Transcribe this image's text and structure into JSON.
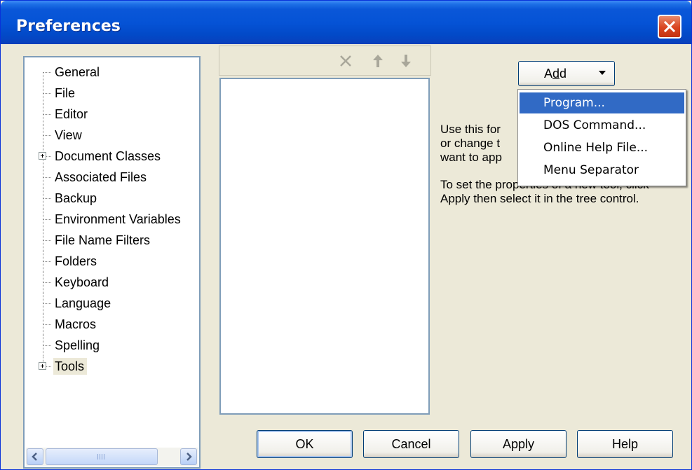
{
  "window": {
    "title": "Preferences"
  },
  "tree": {
    "items": [
      {
        "label": "General",
        "expandable": false
      },
      {
        "label": "File",
        "expandable": false
      },
      {
        "label": "Editor",
        "expandable": false
      },
      {
        "label": "View",
        "expandable": false
      },
      {
        "label": "Document Classes",
        "expandable": true
      },
      {
        "label": "Associated Files",
        "expandable": false
      },
      {
        "label": "Backup",
        "expandable": false
      },
      {
        "label": "Environment Variables",
        "expandable": false
      },
      {
        "label": "File Name Filters",
        "expandable": false
      },
      {
        "label": "Folders",
        "expandable": false
      },
      {
        "label": "Keyboard",
        "expandable": false
      },
      {
        "label": "Language",
        "expandable": false
      },
      {
        "label": "Macros",
        "expandable": false
      },
      {
        "label": "Spelling",
        "expandable": false
      },
      {
        "label": "Tools",
        "expandable": true,
        "selected": true
      }
    ],
    "scrollbar_grip": "III"
  },
  "toolbar": {
    "icons": [
      "delete-icon",
      "move-up-icon",
      "move-down-icon"
    ]
  },
  "add_button": {
    "label": "Add",
    "accesskey": "d"
  },
  "add_menu": {
    "items": [
      "Program...",
      "DOS Command...",
      "Online Help File...",
      "Menu Separator"
    ],
    "highlighted_index": 0
  },
  "help": {
    "line1": "Use this for",
    "line2": "or change t",
    "line3": "want to app",
    "para2": "To set the properties of a new tool, click Apply then select it in the tree control."
  },
  "buttons": {
    "ok": "OK",
    "cancel": "Cancel",
    "apply": "Apply",
    "help": "Help"
  },
  "colors": {
    "titlebar": "#0553d6",
    "highlight": "#316ac5",
    "face": "#ece9d8",
    "close": "#d9441f"
  }
}
